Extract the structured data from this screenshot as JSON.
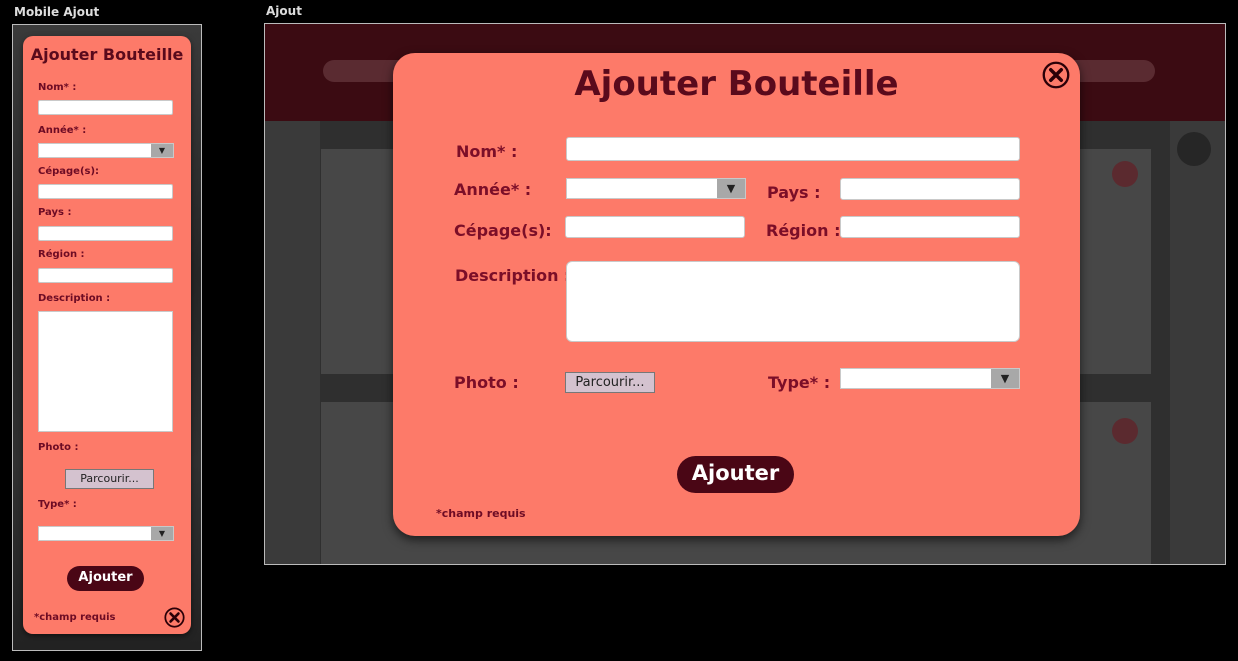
{
  "frames": {
    "mobile_label": "Mobile Ajout",
    "desktop_label": "Ajout"
  },
  "form": {
    "title": "Ajouter Bouteille",
    "nom_label": "Nom* :",
    "annee_label": "Année* :",
    "cepage_label": "Cépage(s):",
    "cepage_label_desktop": "Cépage(s):",
    "pays_label": "Pays :",
    "region_label": "Région :",
    "description_label": "Description :",
    "photo_label": "Photo :",
    "type_label": "Type* :",
    "browse_label": "Parcourir...",
    "submit_label": "Ajouter",
    "required_note": "*champ requis"
  },
  "icons": {
    "close": "close-circle-icon",
    "dropdown": "triangle-down-icon"
  },
  "colors": {
    "card_bg": "#fd7a69",
    "label": "#7b0e28",
    "button": "#4a0615",
    "browse_bg": "#d4c2cf"
  }
}
